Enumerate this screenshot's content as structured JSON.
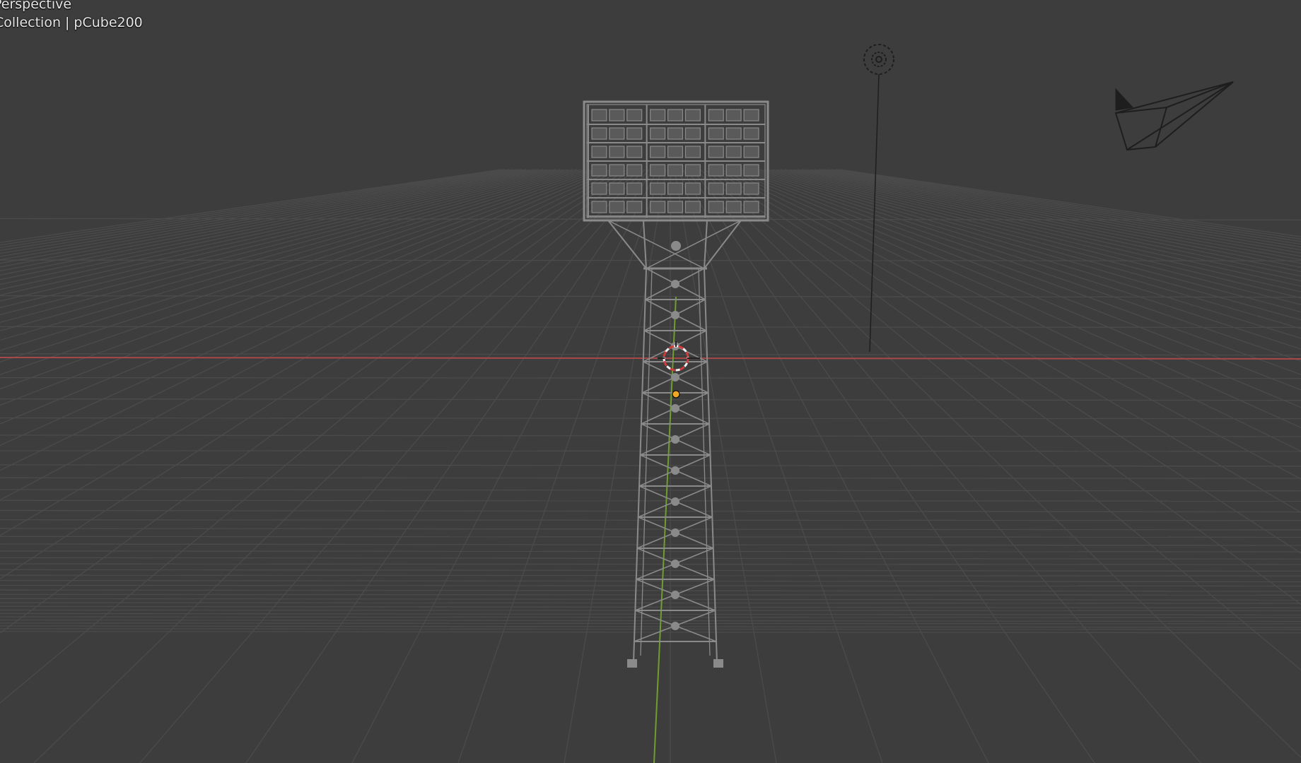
{
  "viewport": {
    "view_name": "Perspective",
    "collection": "Collection",
    "active_object": "pCube200",
    "separator": "|"
  },
  "colors": {
    "background": "#3d3d3d",
    "grid": "#4b4b4b",
    "grid_major": "#555555",
    "x_axis": "#a84848",
    "y_axis": "#6f9e2e",
    "wire": "#8a8a8a",
    "wire_dark": "#1e1e1e",
    "cursor_red": "#d23b3b",
    "cursor_white": "#f0f0f0",
    "origin": "#f2a623"
  },
  "scene_objects": [
    {
      "name": "floodlight-tower",
      "icon": "floodlight-tower-wireframe"
    },
    {
      "name": "light",
      "icon": "spot-light-icon"
    },
    {
      "name": "camera",
      "icon": "camera-icon"
    },
    {
      "name": "3d-cursor",
      "icon": "3d-cursor-icon"
    },
    {
      "name": "object-origin",
      "icon": "origin-dot-icon"
    }
  ]
}
